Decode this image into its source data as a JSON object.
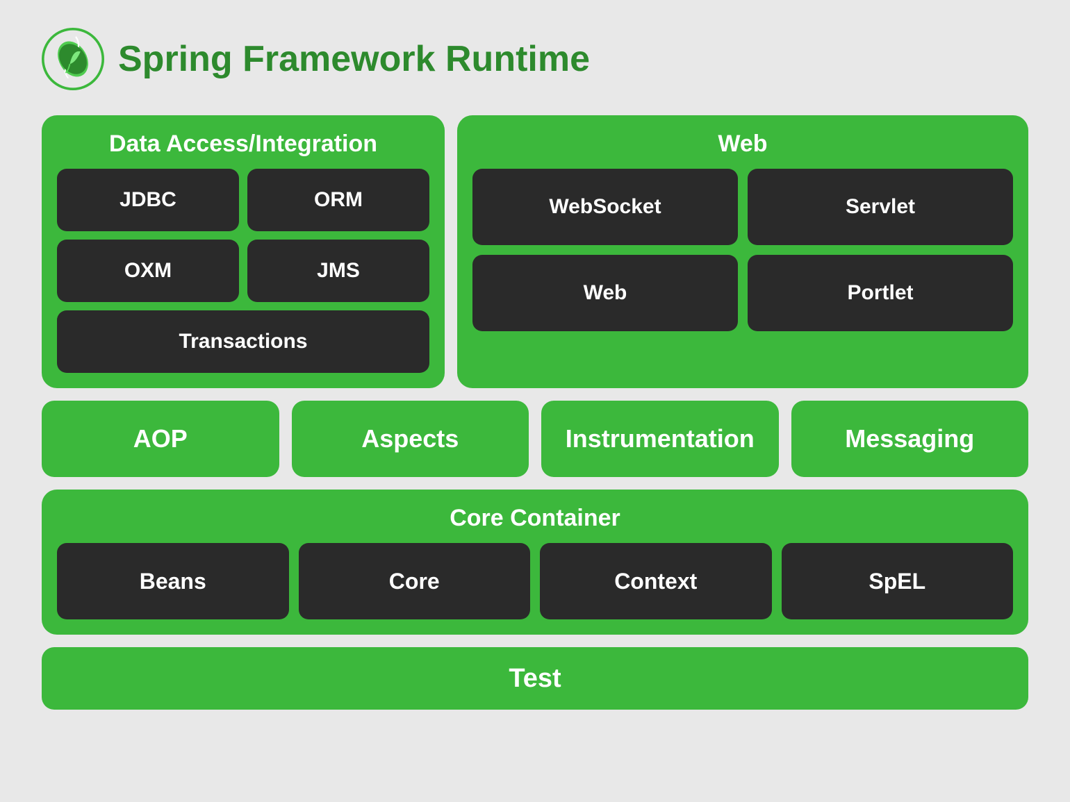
{
  "header": {
    "title": "Spring Framework Runtime",
    "logo_alt": "Spring Logo"
  },
  "data_access": {
    "title": "Data Access/Integration",
    "items": [
      {
        "label": "JDBC"
      },
      {
        "label": "ORM"
      },
      {
        "label": "OXM"
      },
      {
        "label": "JMS"
      },
      {
        "label": "Transactions"
      }
    ]
  },
  "web": {
    "title": "Web",
    "items": [
      {
        "label": "WebSocket"
      },
      {
        "label": "Servlet"
      },
      {
        "label": "Web"
      },
      {
        "label": "Portlet"
      }
    ]
  },
  "middle": {
    "items": [
      {
        "label": "AOP"
      },
      {
        "label": "Aspects"
      },
      {
        "label": "Instrumentation"
      },
      {
        "label": "Messaging"
      }
    ]
  },
  "core_container": {
    "title": "Core Container",
    "items": [
      {
        "label": "Beans"
      },
      {
        "label": "Core"
      },
      {
        "label": "Context"
      },
      {
        "label": "SpEL"
      }
    ]
  },
  "test": {
    "label": "Test"
  }
}
